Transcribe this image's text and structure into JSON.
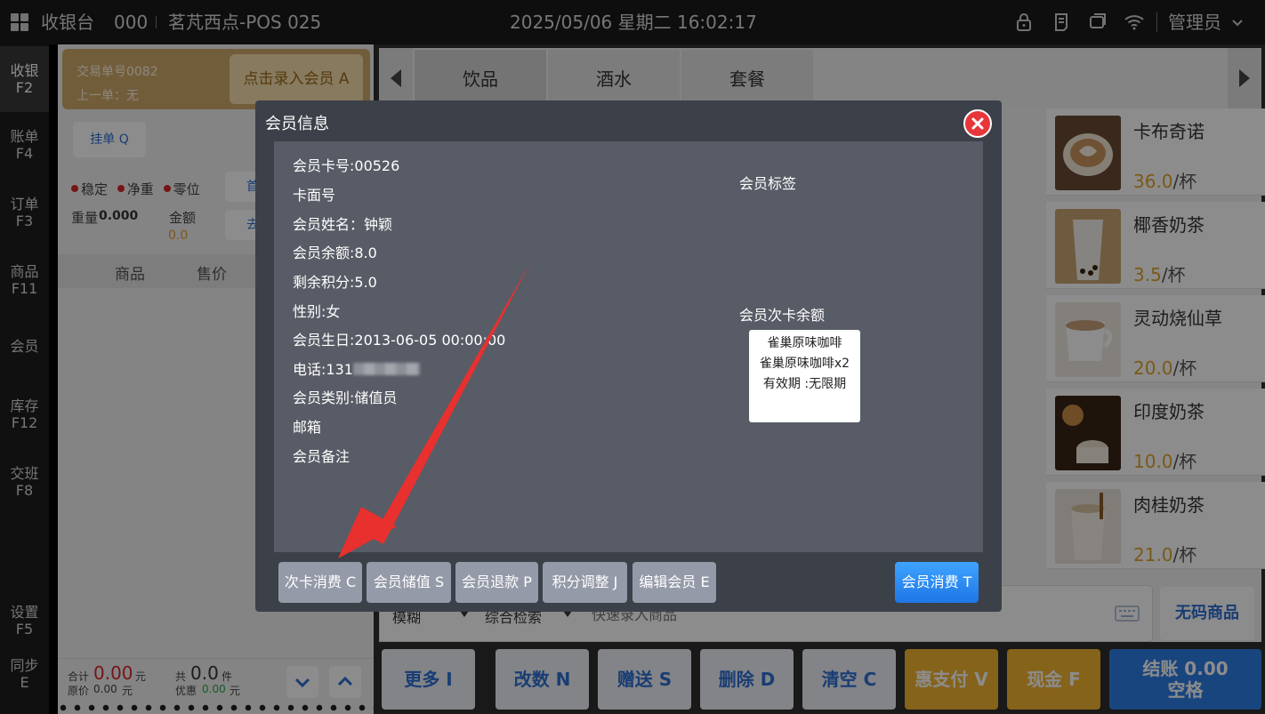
{
  "topbar": {
    "app_title": "收银台",
    "code": "000",
    "store": "茗芃西点-POS 025",
    "datetime": "2025/05/06 星期二 16:02:17",
    "user": "管理员"
  },
  "nav": {
    "items": [
      {
        "label": "收银",
        "key": "F2"
      },
      {
        "label": "账单",
        "key": "F4"
      },
      {
        "label": "订单",
        "key": "F3"
      },
      {
        "label": "商品",
        "key": "F11"
      },
      {
        "label": "会员",
        "key": ""
      },
      {
        "label": "库存",
        "key": "F12"
      },
      {
        "label": "交班",
        "key": "F8"
      },
      {
        "label": "设置",
        "key": "F5"
      },
      {
        "label": "同步",
        "key": "E"
      }
    ]
  },
  "cart": {
    "trade_no": "交易单号0082",
    "last_order": "上一单：无",
    "member_entry": "点击录入会员 A",
    "hang": "挂单 Q",
    "stable": "稳定",
    "net": "净重",
    "zero": "零位",
    "weight_label": "重量",
    "weight_value": "0.000",
    "amount_label": "金额",
    "amount_value": "0.0",
    "side1": "首",
    "side2": "去",
    "col_product": "商品",
    "col_price": "售价",
    "total_label": "合计",
    "total_value": "0.00",
    "yuan": "元",
    "count_label": "共",
    "count_value": "0.0",
    "jian": "件",
    "orig_label": "原价",
    "orig_value": "0.00",
    "disc_label": "优惠",
    "disc_value": "0.00"
  },
  "tabs": [
    "饮品",
    "酒水",
    "套餐"
  ],
  "products": [
    {
      "name": "卡布奇诺",
      "price": "36.0",
      "unit": "/杯"
    },
    {
      "name": "椰香奶茶",
      "price": "3.5",
      "unit": "/杯"
    },
    {
      "name": "灵动烧仙草",
      "price": "20.0",
      "unit": "/杯"
    },
    {
      "name": "印度奶茶",
      "price": "10.0",
      "unit": "/杯"
    },
    {
      "name": "肉桂奶茶",
      "price": "21.0",
      "unit": "/杯"
    }
  ],
  "colors": {
    "accent_blue": "#2f7fe6",
    "gold": "#f3b532",
    "danger": "#e8353a"
  },
  "search": {
    "mode": "模糊",
    "type": "综合检索",
    "placeholder": "快速录入商品"
  },
  "no_code": "无码商品",
  "bottom_buttons": [
    "更多 I",
    "改数 N",
    "赠送 S",
    "删除 D",
    "清空 C",
    "惠支付 V",
    "现金 F"
  ],
  "checkout": {
    "line1": "结账 0.00",
    "line2": "空格"
  },
  "modal": {
    "title": "会员信息",
    "card_no": "会员卡号:00526",
    "face_no": "卡面号",
    "name": "会员姓名：钟颖",
    "balance": "会员余额:8.0",
    "points": "剩余积分:5.0",
    "gender": "性别:女",
    "birthday": "会员生日:2013-06-05 00:00:00",
    "phone": "电话:131",
    "category": "会员类别:储值员",
    "email": "邮箱",
    "remark": "会员备注",
    "tag_label": "会员标签",
    "times_label": "会员次卡余额",
    "card_item": {
      "line1": "雀巢原味咖啡",
      "line2": "雀巢原味咖啡x2",
      "line3": "有效期 :无限期"
    },
    "buttons": [
      "次卡消费 C",
      "会员储值 S",
      "会员退款 P",
      "积分调整 J",
      "编辑会员 E"
    ],
    "primary_button": "会员消费 T"
  }
}
